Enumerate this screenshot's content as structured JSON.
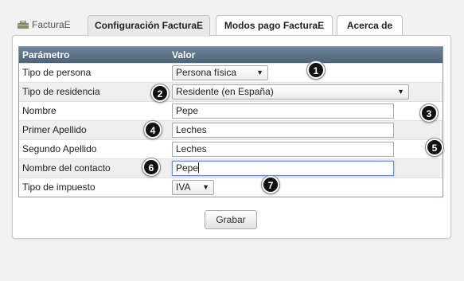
{
  "tabs": [
    {
      "label": "FacturaE",
      "icon": "toolbox-icon"
    },
    {
      "label": "Configuración FacturaE"
    },
    {
      "label": "Modos pago FacturaE"
    },
    {
      "label": "Acerca de"
    }
  ],
  "grid": {
    "header_param": "Parámetro",
    "header_value": "Valor",
    "rows": [
      {
        "label": "Tipo de persona",
        "value": "Persona física"
      },
      {
        "label": "Tipo de residencia",
        "value": "Residente (en España)"
      },
      {
        "label": "Nombre",
        "value": "Pepe"
      },
      {
        "label": "Primer Apellido",
        "value": "Leches"
      },
      {
        "label": "Segundo Apellido",
        "value": "Leches"
      },
      {
        "label": "Nombre del contacto",
        "value": "Pepe"
      },
      {
        "label": "Tipo de impuesto",
        "value": "IVA"
      }
    ]
  },
  "save_button": "Grabar",
  "badges": [
    "1",
    "2",
    "3",
    "4",
    "5",
    "6",
    "7"
  ]
}
